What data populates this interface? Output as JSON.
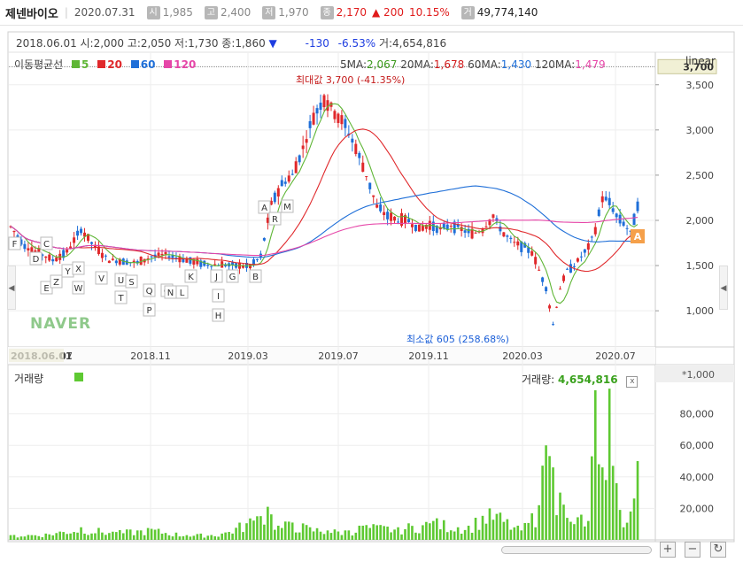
{
  "header": {
    "name": "제넨바이오",
    "date": "2020.07.31",
    "open_label": "시",
    "open": "1,985",
    "high_label": "고",
    "high": "2,400",
    "low_label": "저",
    "low": "1,970",
    "close_label": "종",
    "close": "2,170",
    "change": "▲ 200",
    "change_pct": "10.15%",
    "vol_label": "거",
    "volume": "49,774,140"
  },
  "info": {
    "text": "2018.06.01 시:2,000 고:2,050 저:1,730 종:1,860",
    "arrow": "▼",
    "change": "-130",
    "pct": "-6.53%",
    "vol": "거:4,654,816"
  },
  "legend": {
    "title": "이동평균선",
    "ma5": "5",
    "ma20": "20",
    "ma60": "60",
    "ma120": "120",
    "ma5_color": "#5fb636",
    "ma20_color": "#e0282b",
    "ma60_color": "#1f6fd8",
    "ma120_color": "#e646a8"
  },
  "ma_values": {
    "ma5_label": "5MA:",
    "ma5": "2,067",
    "ma20_label": "20MA:",
    "ma20": "1,678",
    "ma60_label": "60MA:",
    "ma60": "1,430",
    "ma120_label": "120MA:",
    "ma120": "1,479"
  },
  "scale_label": "linear",
  "max_label": "최대값 3,700 (-41.35%)",
  "min_label": "최소값 605 (258.68%)",
  "watermark": "NAVER",
  "volume_panel": {
    "title": "거래량",
    "reading_label": "거래량:",
    "reading": "4,654,816",
    "close_icon": "x",
    "unit": "*1,000"
  },
  "controls": {
    "zoom_in": "+",
    "zoom_out": "−",
    "reset": "↻",
    "left_arrow": "◀",
    "right_arrow": "◀"
  },
  "chart_data": {
    "type": "candlestick",
    "price_axis": {
      "min": 600,
      "max": 3850,
      "ticks": [
        1000,
        1500,
        2000,
        2500,
        3000,
        3500
      ],
      "tick_labels": [
        "1,000",
        "1,500",
        "2,000",
        "2,500",
        "3,000",
        "3,500"
      ],
      "highlight": "3,700"
    },
    "x_ticks": [
      "2018.06.01",
      "07",
      "2018.11",
      "2019.03",
      "2019.07",
      "2019.11",
      "2020.03",
      "2020.07"
    ],
    "volume_axis": {
      "min": 0,
      "max": 100000,
      "ticks": [
        20000,
        40000,
        60000,
        80000
      ],
      "tick_labels": [
        "20,000",
        "40,000",
        "60,000",
        "80,000"
      ]
    },
    "price_keypoints": [
      [
        0,
        1930
      ],
      [
        4,
        1720
      ],
      [
        8,
        1640
      ],
      [
        12,
        1560
      ],
      [
        16,
        1650
      ],
      [
        20,
        1900
      ],
      [
        24,
        1700
      ],
      [
        28,
        1560
      ],
      [
        32,
        1550
      ],
      [
        36,
        1530
      ],
      [
        40,
        1600
      ],
      [
        44,
        1620
      ],
      [
        48,
        1580
      ],
      [
        52,
        1540
      ],
      [
        56,
        1510
      ],
      [
        60,
        1510
      ],
      [
        64,
        1500
      ],
      [
        68,
        1490
      ],
      [
        71,
        1600
      ],
      [
        74,
        2180
      ],
      [
        77,
        2400
      ],
      [
        80,
        2500
      ],
      [
        83,
        2800
      ],
      [
        86,
        3150
      ],
      [
        89,
        3350
      ],
      [
        92,
        3200
      ],
      [
        95,
        3050
      ],
      [
        98,
        2800
      ],
      [
        101,
        2500
      ],
      [
        104,
        2150
      ],
      [
        107,
        2050
      ],
      [
        110,
        2000
      ],
      [
        113,
        2000
      ],
      [
        116,
        1900
      ],
      [
        119,
        1950
      ],
      [
        122,
        1900
      ],
      [
        125,
        1950
      ],
      [
        128,
        1900
      ],
      [
        131,
        1850
      ],
      [
        134,
        1900
      ],
      [
        137,
        2050
      ],
      [
        140,
        1850
      ],
      [
        143,
        1750
      ],
      [
        146,
        1700
      ],
      [
        148,
        1650
      ],
      [
        150,
        1450
      ],
      [
        152,
        1250
      ],
      [
        154,
        850
      ],
      [
        156,
        1250
      ],
      [
        158,
        1450
      ],
      [
        160,
        1500
      ],
      [
        162,
        1600
      ],
      [
        164,
        1700
      ],
      [
        166,
        1900
      ],
      [
        168,
        2250
      ],
      [
        170,
        2200
      ],
      [
        172,
        2050
      ],
      [
        174,
        1970
      ],
      [
        176,
        1860
      ],
      [
        178,
        2170
      ]
    ],
    "ma5": [
      2067
    ],
    "ma20": [
      1678
    ],
    "ma60": [
      1430
    ],
    "ma120": [
      1479
    ],
    "volume_spikes": [
      [
        0,
        3000
      ],
      [
        10,
        4000
      ],
      [
        20,
        8000
      ],
      [
        30,
        5000
      ],
      [
        40,
        7000
      ],
      [
        50,
        3000
      ],
      [
        60,
        4000
      ],
      [
        70,
        15000
      ],
      [
        73,
        21000
      ],
      [
        76,
        9000
      ],
      [
        80,
        11000
      ],
      [
        85,
        8000
      ],
      [
        90,
        6000
      ],
      [
        96,
        6000
      ],
      [
        100,
        9000
      ],
      [
        110,
        8000
      ],
      [
        120,
        12000
      ],
      [
        130,
        9000
      ],
      [
        136,
        20000
      ],
      [
        145,
        6000
      ],
      [
        150,
        22000
      ],
      [
        152,
        60000
      ],
      [
        154,
        46000
      ],
      [
        156,
        30000
      ],
      [
        158,
        14000
      ],
      [
        160,
        10000
      ],
      [
        162,
        16000
      ],
      [
        164,
        12000
      ],
      [
        166,
        95000
      ],
      [
        167,
        48000
      ],
      [
        168,
        46000
      ],
      [
        169,
        38000
      ],
      [
        170,
        96000
      ],
      [
        171,
        47000
      ],
      [
        172,
        36000
      ],
      [
        174,
        8000
      ],
      [
        176,
        18000
      ],
      [
        178,
        50000
      ]
    ],
    "annotations": [
      "F",
      "D",
      "C",
      "E",
      "Z",
      "Y",
      "X",
      "W",
      "V",
      "U",
      "S",
      "T",
      "Q",
      "P",
      "O",
      "N",
      "L",
      "K",
      "J",
      "I",
      "H",
      "G",
      "B",
      "A",
      "R",
      "M"
    ]
  }
}
